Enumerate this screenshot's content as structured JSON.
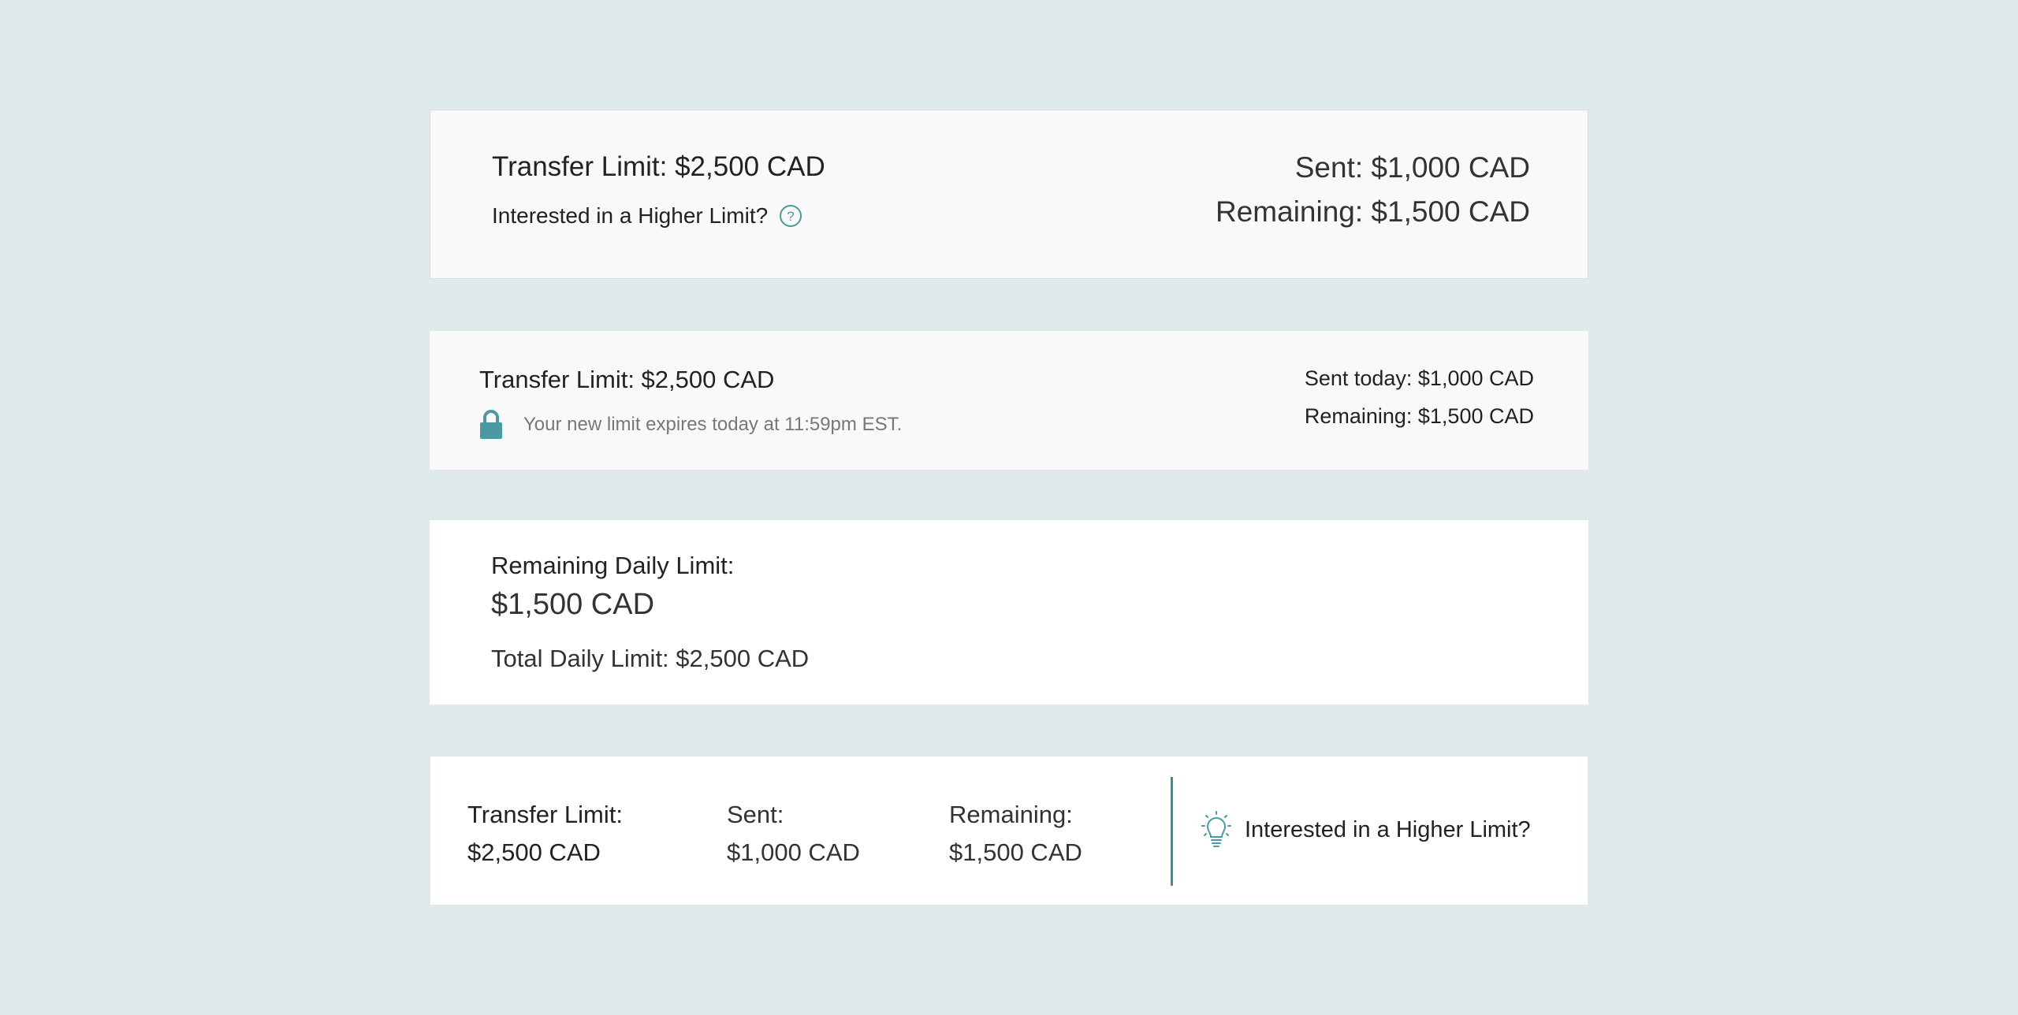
{
  "colors": {
    "background": "#e1eaeb",
    "accent": "#4a9aa3",
    "card": "#f9f9f9"
  },
  "card1": {
    "title": "Transfer Limit: $2,500 CAD",
    "subtitle": "Interested in a Higher Limit?",
    "help_icon": "question-circle-icon",
    "sent": "Sent: $1,000 CAD",
    "remaining": "Remaining: $1,500 CAD"
  },
  "card2": {
    "title": "Transfer Limit: $2,500 CAD",
    "lock_icon": "lock-icon",
    "note": "Your new limit expires today at 11:59pm EST.",
    "sent_today": "Sent today: $1,000 CAD",
    "remaining": "Remaining: $1,500 CAD"
  },
  "card3": {
    "label": "Remaining Daily Limit:",
    "amount": "$1,500 CAD",
    "total": "Total Daily Limit: $2,500 CAD"
  },
  "card4": {
    "limit_label": "Transfer Limit:",
    "limit_value": "$2,500 CAD",
    "sent_label": "Sent:",
    "sent_value": "$1,000 CAD",
    "remaining_label": "Remaining:",
    "remaining_value": "$1,500 CAD",
    "promo_icon": "lightbulb-icon",
    "promo_text": "Interested in a Higher Limit?"
  }
}
